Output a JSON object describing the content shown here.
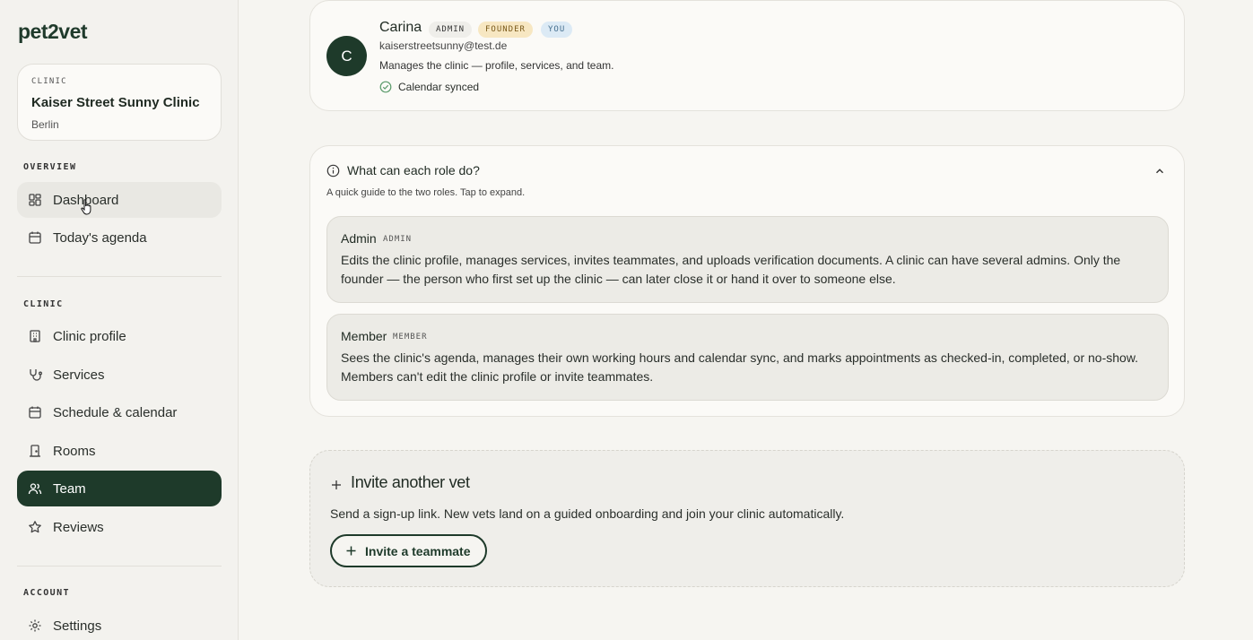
{
  "brand": {
    "logo_pre": "pet",
    "logo_mid": "2",
    "logo_post": "vet"
  },
  "clinic_card": {
    "caption": "CLINIC",
    "name": "Kaiser Street Sunny Clinic",
    "city": "Berlin"
  },
  "sidebar": {
    "sections": {
      "overview": "OVERVIEW",
      "clinic": "CLINIC",
      "account": "ACCOUNT"
    },
    "items": {
      "dashboard": "Dashboard",
      "agenda": "Today's agenda",
      "clinic_profile": "Clinic profile",
      "services": "Services",
      "schedule": "Schedule & calendar",
      "rooms": "Rooms",
      "team": "Team",
      "reviews": "Reviews",
      "settings": "Settings"
    },
    "active": "team"
  },
  "member": {
    "initial": "C",
    "name": "Carina",
    "badges": {
      "admin": "ADMIN",
      "founder": "FOUNDER",
      "you": "YOU"
    },
    "email": "kaiserstreetsunny@test.de",
    "description": "Manages the clinic — profile, services, and team.",
    "calendar_status": "Calendar synced"
  },
  "roles_help": {
    "title": "What can each role do?",
    "subtitle": "A quick guide to the two roles. Tap to expand.",
    "admin": {
      "title": "Admin",
      "tag": "ADMIN",
      "description": "Edits the clinic profile, manages services, invites teammates, and uploads verification documents. A clinic can have several admins. Only the founder — the person who first set up the clinic — can later close it or hand it over to someone else."
    },
    "member": {
      "title": "Member",
      "tag": "MEMBER",
      "description": "Sees the clinic's agenda, manages their own working hours and calendar sync, and marks appointments as checked-in, completed, or no-show. Members can't edit the clinic profile or invite teammates."
    }
  },
  "invite": {
    "title": "Invite another vet",
    "text": "Send a sign-up link. New vets land on a guided onboarding and join your clinic automatically.",
    "button": "Invite a teammate"
  },
  "colors": {
    "accent": "#1e3a2a",
    "founder_badge": "#f7e7c2",
    "you_badge": "#dceaf5",
    "synced": "#5a9a6a"
  }
}
